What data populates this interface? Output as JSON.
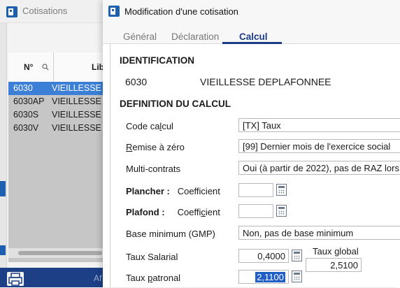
{
  "background_window": {
    "title": "Cotisations",
    "columns": {
      "no": "N°",
      "libelle": "Lib"
    },
    "rows": [
      {
        "code": "6030",
        "libelle": "VIEILLESSE D",
        "selected": true
      },
      {
        "code": "6030AP",
        "libelle": "VIEILLESSE D",
        "selected": false
      },
      {
        "code": "6030S",
        "libelle": "VIEILLESSE D",
        "selected": false
      },
      {
        "code": "6030V",
        "libelle": "VIEILLESSE D",
        "selected": false
      }
    ],
    "footer_text": "Af"
  },
  "dialog": {
    "title": "Modification d'une cotisation",
    "tabs": [
      "Général",
      "Déclaration",
      "Calcul"
    ],
    "active_tab": "Calcul",
    "identification": {
      "heading": "IDENTIFICATION",
      "code": "6030",
      "libelle": "VIEILLESSE DEPLAFONNEE"
    },
    "definition": {
      "heading": "DEFINITION DU CALCUL",
      "code_calcul": {
        "label_a": "Code ca",
        "label_u": "l",
        "label_b": "cul",
        "value": "[TX]  Taux"
      },
      "remise_zero": {
        "label_u": "R",
        "label_b": "emise à zéro",
        "value": "[99] Dernier mois de l'exercice social"
      },
      "multi_contrats": {
        "label": "Multi-contrats",
        "value": "Oui (à partir de 2022), pas de RAZ lors"
      },
      "plancher": {
        "label": "Plancher :",
        "coef_a": "Coefficient",
        "value": ""
      },
      "plafond": {
        "label": "Plafond :",
        "coef_a": "Coeffi",
        "coef_u": "c",
        "coef_b": "ient",
        "value": ""
      },
      "base_minimum": {
        "label": "Base minimum (GMP)",
        "value": "Non, pas de base minimum"
      },
      "taux_salarial": {
        "label": "Taux Salarial",
        "value": "0,4000"
      },
      "taux_global": {
        "label": "Taux global",
        "value": "2,5100"
      },
      "taux_patronal": {
        "label_a": "Taux ",
        "label_u": "p",
        "label_b": "atronal",
        "value": "2,1100"
      }
    }
  },
  "colors": {
    "accent": "#1b3c87",
    "selection": "#3b7fd6",
    "footer": "#1d3f86"
  }
}
